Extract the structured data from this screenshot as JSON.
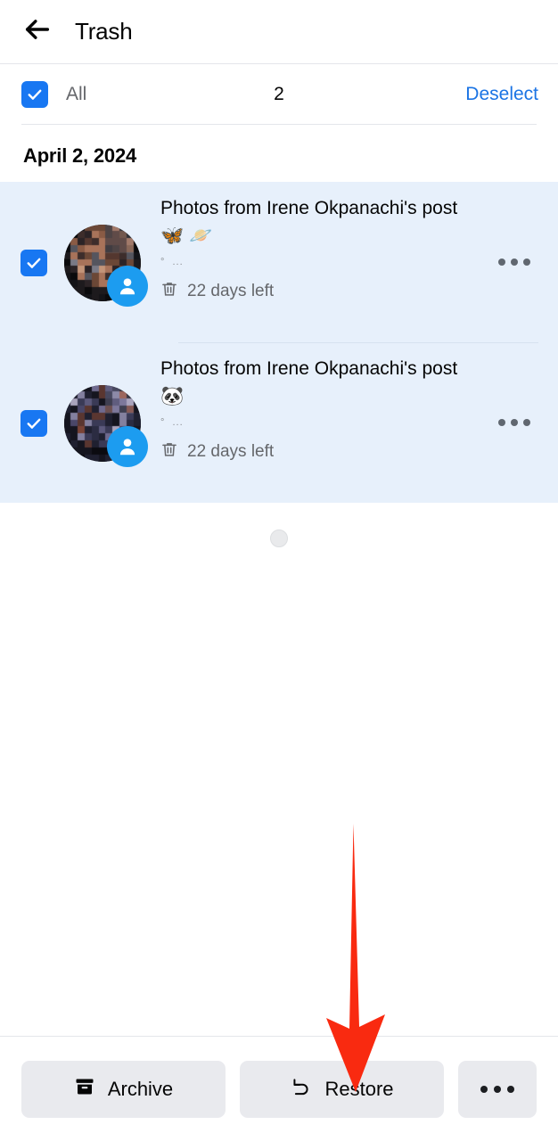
{
  "appbar": {
    "back_icon": "arrow-left-icon",
    "title": "Trash"
  },
  "selectbar": {
    "checkbox_checked": true,
    "all_label": "All",
    "count": "2",
    "action_label": "Deselect"
  },
  "list": {
    "date_header": "April 2, 2024",
    "items": [
      {
        "checked": true,
        "avatar_badge_icon": "person-icon",
        "title": "Photos from Irene Okpanachi's post",
        "emoji": "🦋 🪐",
        "meta_dot": "°",
        "meta_ellipsis": "...",
        "expiry_icon": "trash-icon",
        "expiry": "22 days left",
        "more_icon": "overflow-menu-icon"
      },
      {
        "checked": true,
        "avatar_badge_icon": "person-icon",
        "title": "Photos from Irene Okpanachi's post",
        "emoji": "🐼",
        "meta_dot": "°",
        "meta_ellipsis": "...",
        "expiry_icon": "trash-icon",
        "expiry": "22 days left",
        "more_icon": "overflow-menu-icon"
      }
    ],
    "loading_indicator": "loading-spinner"
  },
  "bottombar": {
    "archive_label": "Archive",
    "archive_icon": "archive-box-icon",
    "restore_label": "Restore",
    "restore_icon": "undo-arrow-icon",
    "overflow_icon": "overflow-menu-icon"
  },
  "annotation": {
    "arrow": "red-down-arrow",
    "color": "#f92a10",
    "points_at": "Restore"
  },
  "colors": {
    "accent_blue": "#1877f2",
    "link_blue": "#1b74e4",
    "selected_row_bg": "#e7f0fb",
    "badge_blue": "#1c9cf0",
    "button_grey": "#e9eaee",
    "text_primary": "#050505",
    "text_secondary": "#65676b",
    "annotation_red": "#f92a10"
  }
}
